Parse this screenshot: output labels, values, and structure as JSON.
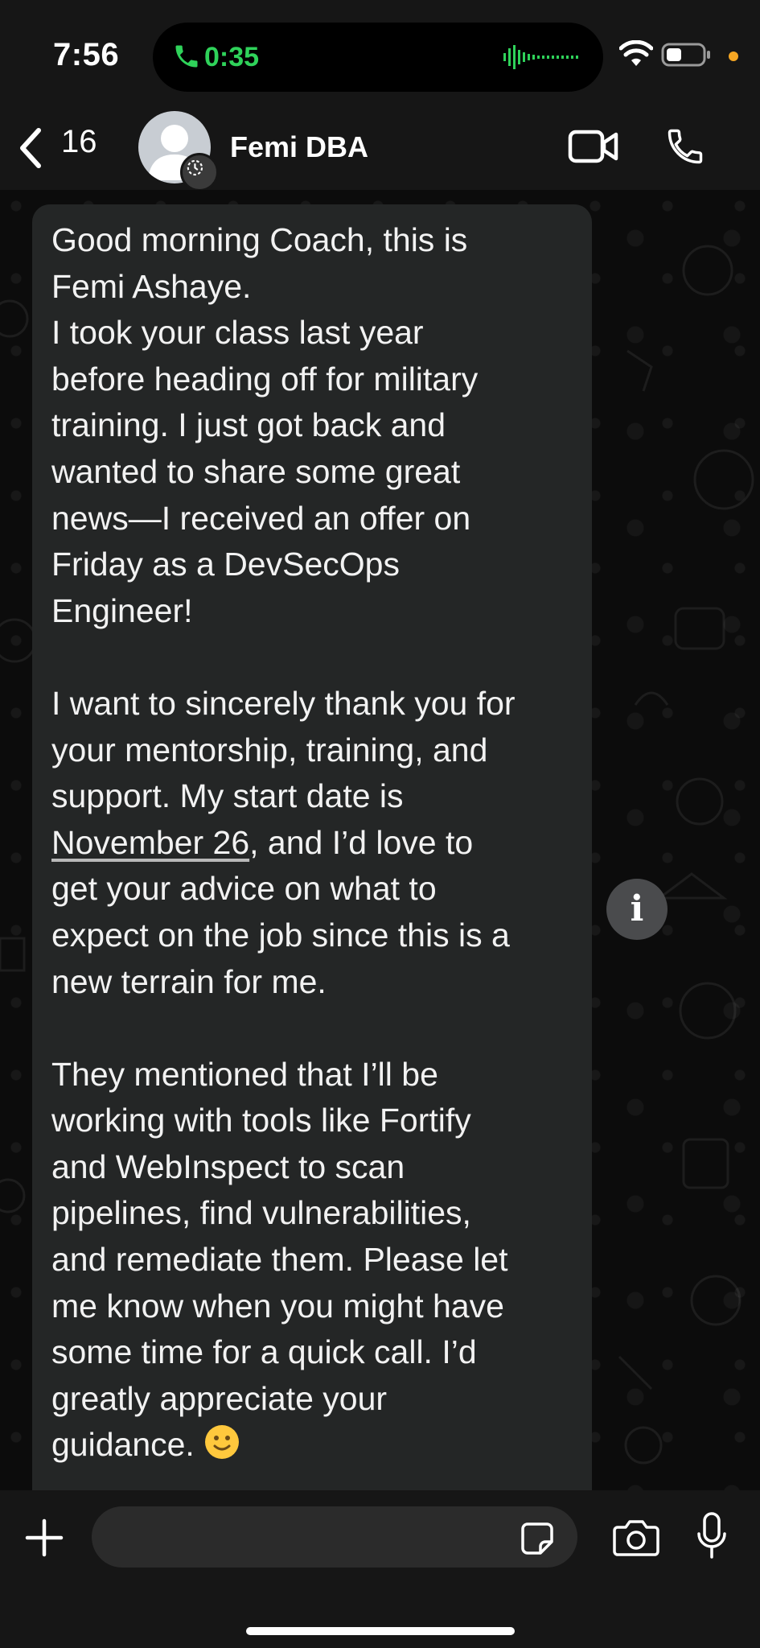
{
  "status_bar": {
    "time": "7:56",
    "call_timer": "0:35",
    "call_color": "#2fd25a",
    "icons": [
      "phone-icon",
      "audio-waveform-icon",
      "wifi-icon",
      "battery-icon",
      "orange-dot-indicator"
    ]
  },
  "header": {
    "back_count": "16",
    "contact_name": "Femi DBA",
    "icons": [
      "back-chevron-icon",
      "avatar",
      "disappearing-timer-icon",
      "video-call-icon",
      "voice-call-icon"
    ]
  },
  "message": {
    "paragraph1": "Good morning Coach, this is\nFemi Ashaye.\nI took your class last year\nbefore heading off for military\ntraining. I just got back and\nwanted to share some great\nnews—I received an offer on\nFriday as a DevSecOps\nEngineer!",
    "paragraph2_before_date": "I want to sincerely thank you for\nyour mentorship, training, and\nsupport. My start date is\n",
    "date_link": "November 26",
    "paragraph2_after_date": ", and I’d love to\nget your advice on what to\nexpect on the job since this is a\nnew terrain for me.",
    "paragraph3": "They mentioned that I’ll be\nworking with tools like Fortify\nand WebInspect to scan\npipelines, find vulnerabilities,\nand remediate them. Please let\nme know when you might have\nsome time for a quick call. I’d\ngreatly appreciate your\nguidance. ",
    "emoji": "slightly-smiling-face-emoji",
    "bubble_color": "#242626"
  },
  "info_button": {
    "label": "i"
  },
  "input_bar": {
    "placeholder": "",
    "icons": [
      "plus-icon",
      "sticker-icon",
      "camera-icon",
      "microphone-icon"
    ]
  }
}
